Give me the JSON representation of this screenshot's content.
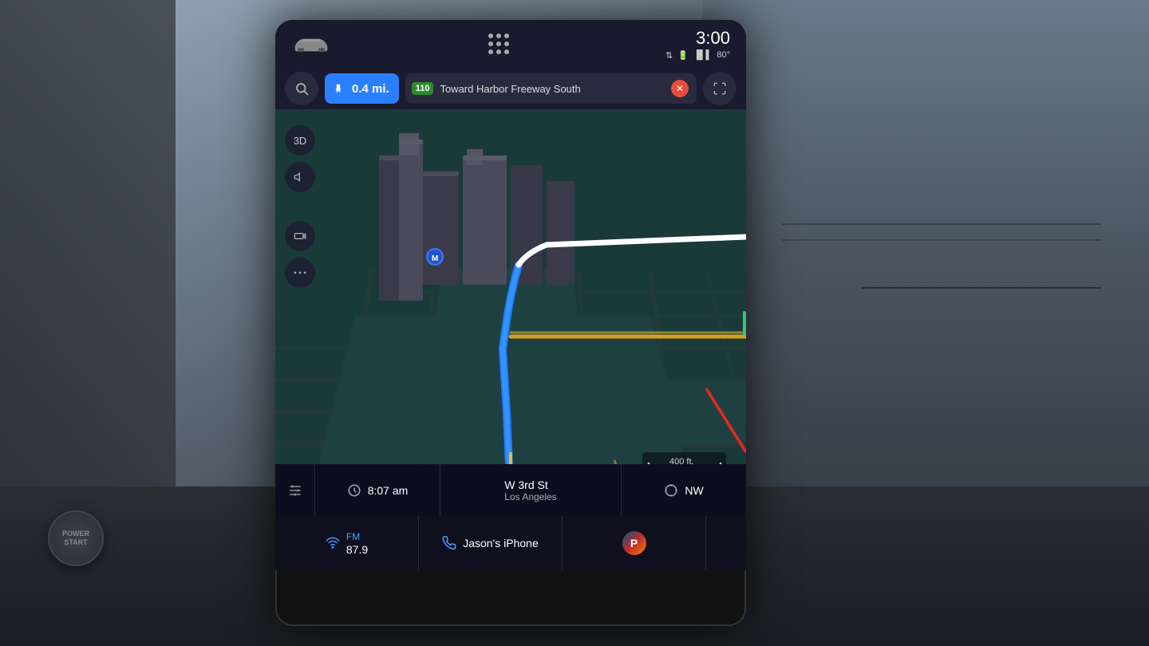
{
  "screen": {
    "status_bar": {
      "time": "3:00",
      "temperature": "80°",
      "signal_bars": "|||",
      "battery_icon": "🔋"
    },
    "nav_bar": {
      "search_label": "Search",
      "distance": "0.4 mi.",
      "highway_number": "110",
      "highway_shield": "⬡",
      "route_description": "Toward Harbor Freeway South",
      "close_label": "✕",
      "expand_label": "⛶"
    },
    "map": {
      "view_mode": "3D",
      "scale": "400 ft.",
      "location_street": "W 3rd St",
      "location_city": "Los Angeles",
      "direction": "NW",
      "arrival_time": "8:07 am"
    },
    "map_controls": {
      "view_3d": "3D",
      "volume_icon": "🔈",
      "camera_icon": "📷"
    },
    "bottom_bar": {
      "radio_icon": "📻",
      "radio_label": "FM",
      "radio_frequency": "87.9",
      "phone_icon": "📞",
      "phone_label": "Jason's iPhone",
      "pandora_letter": "P",
      "green_indicator": ""
    },
    "info_row": {
      "time_icon": "🕐",
      "arrival_time": "8:07 am",
      "street": "W 3rd St",
      "city": "Los Angeles",
      "compass_direction": "NW",
      "tools_icon": "✂"
    }
  }
}
